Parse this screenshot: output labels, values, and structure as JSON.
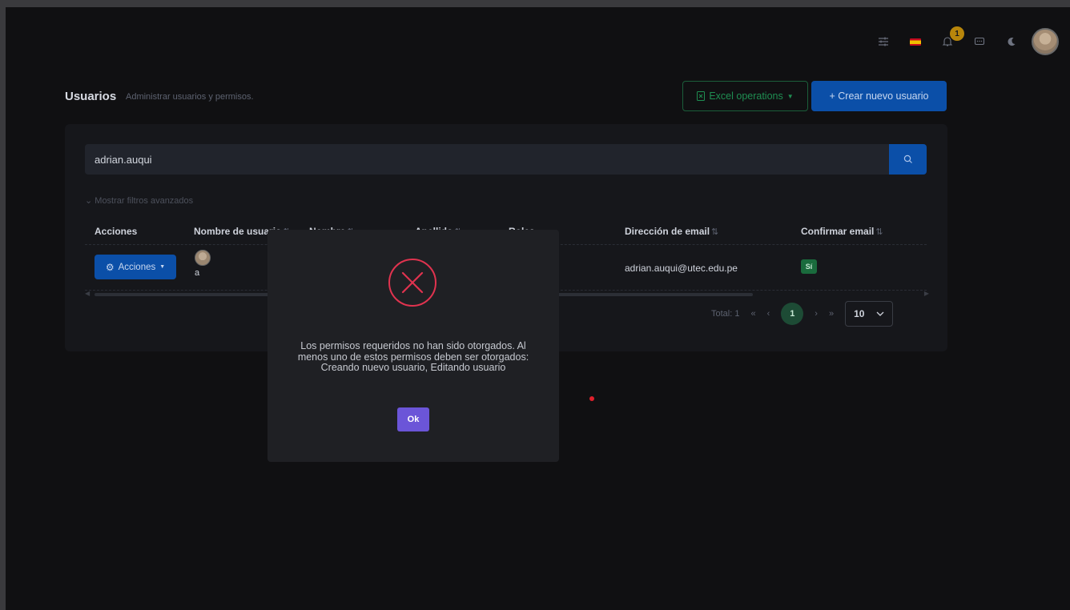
{
  "header": {
    "title": "Usuarios",
    "subtitle": "Administrar usuarios y permisos.",
    "excel_label": "Excel operations",
    "create_label": "+ Crear nuevo usuario"
  },
  "topbar": {
    "notifications_count": "1",
    "icons": [
      "settings-sliders-icon",
      "spain-flag-icon",
      "bell-icon",
      "chat-icon",
      "moon-icon",
      "user-avatar"
    ]
  },
  "search": {
    "value": "adrian.auqui"
  },
  "filters": {
    "toggle_label": "Mostrar filtros avanzados"
  },
  "table": {
    "columns": [
      "Acciones",
      "Nombre de usuario",
      "Nombre",
      "Apellido",
      "Roles",
      "Dirección de email",
      "Confirmar email"
    ],
    "sort_icon": "⇅",
    "rows": [
      {
        "actions_label": "Acciones",
        "username": "a",
        "email": "adrian.auqui@utec.edu.pe",
        "confirmed": "Sí"
      }
    ]
  },
  "pagination": {
    "total": "Total: 1",
    "first": "«",
    "prev": "‹",
    "current": "1",
    "next": "›",
    "last": "»",
    "page_size": "10"
  },
  "dialog": {
    "message": "Los permisos requeridos no han sido otorgados. Al menos uno de estos permisos deben ser otorgados: Creando nuevo usuario, Editando usuario",
    "ok_label": "Ok"
  },
  "colors": {
    "primary": "#0b4fa8",
    "success": "#1a6b3d",
    "error": "#e0334f",
    "ok_button": "#6b55d8"
  }
}
